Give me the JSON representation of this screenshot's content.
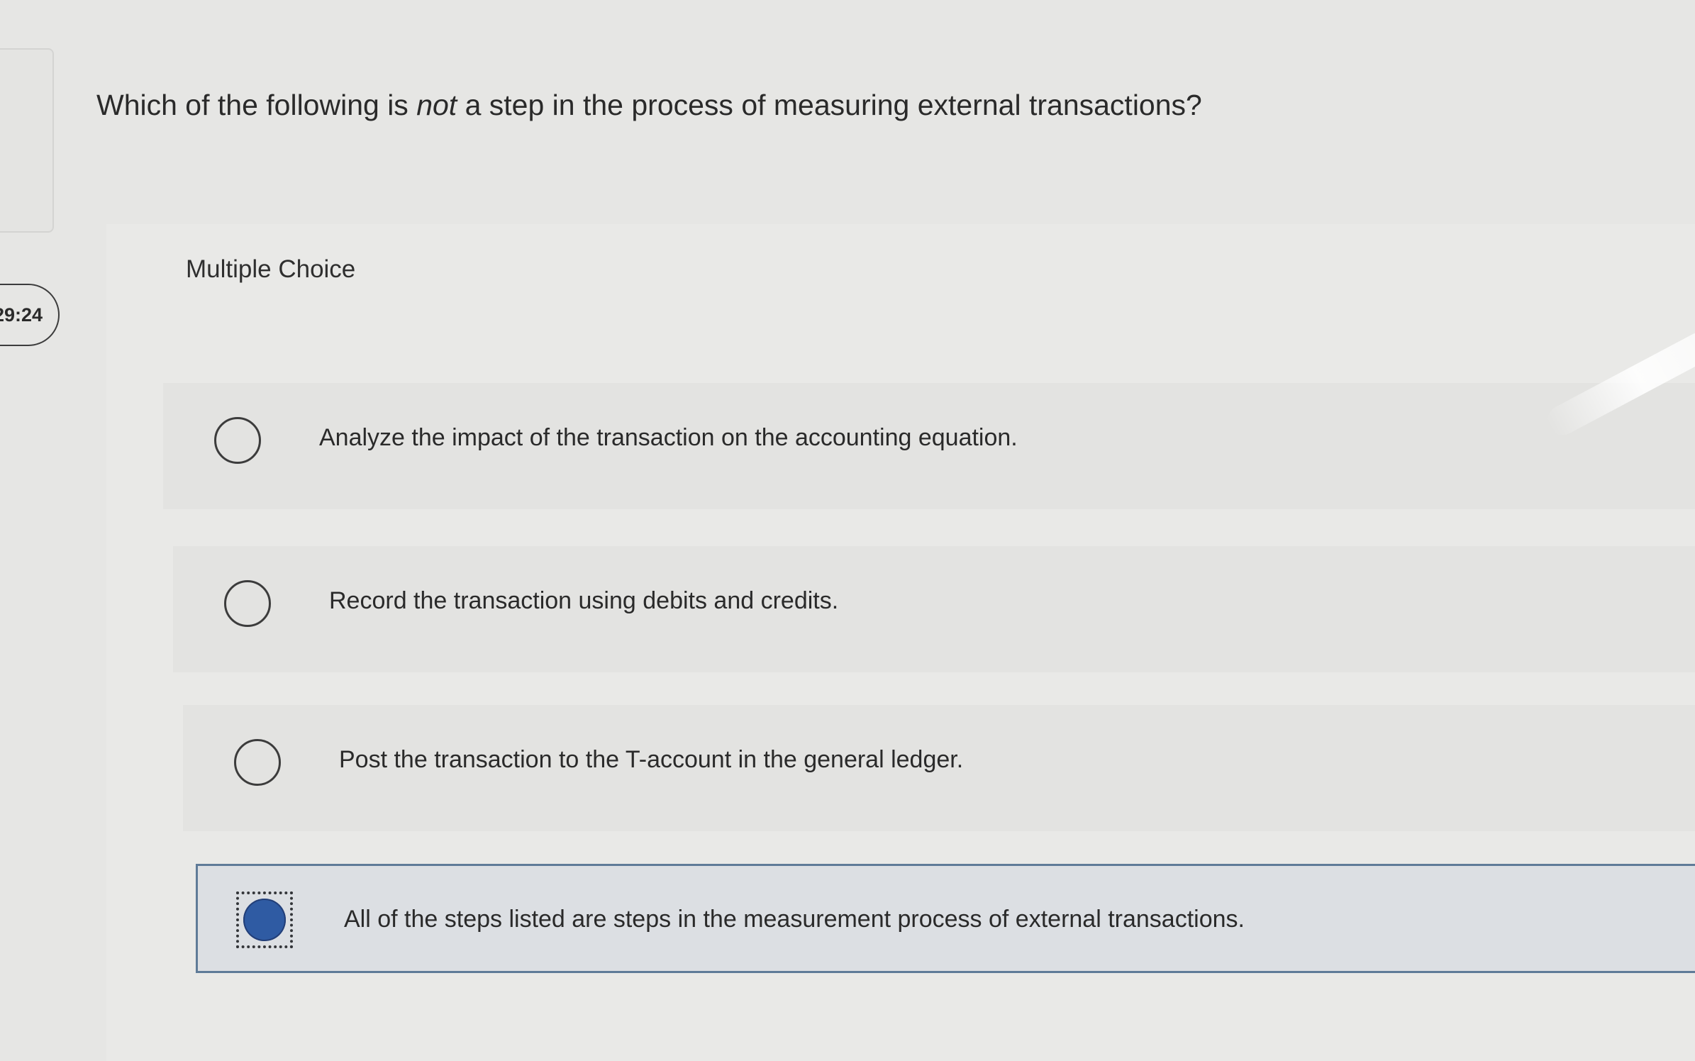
{
  "timer": {
    "value": "29:24"
  },
  "question": {
    "before": "Which of the following is ",
    "emphasis": "not",
    "after": " a step in the process of measuring external transactions?"
  },
  "panel": {
    "label": "Multiple Choice"
  },
  "options": [
    {
      "text": "Analyze the impact of the transaction on the accounting equation.",
      "selected": false
    },
    {
      "text": "Record the transaction using debits and credits.",
      "selected": false
    },
    {
      "text": "Post the transaction to the T-account in the general ledger.",
      "selected": false
    },
    {
      "text": "All of the steps listed are steps in the measurement process of external transactions.",
      "selected": true
    }
  ],
  "colors": {
    "selected_radio": "#2f5ba3",
    "selected_border": "#5f7b98"
  }
}
